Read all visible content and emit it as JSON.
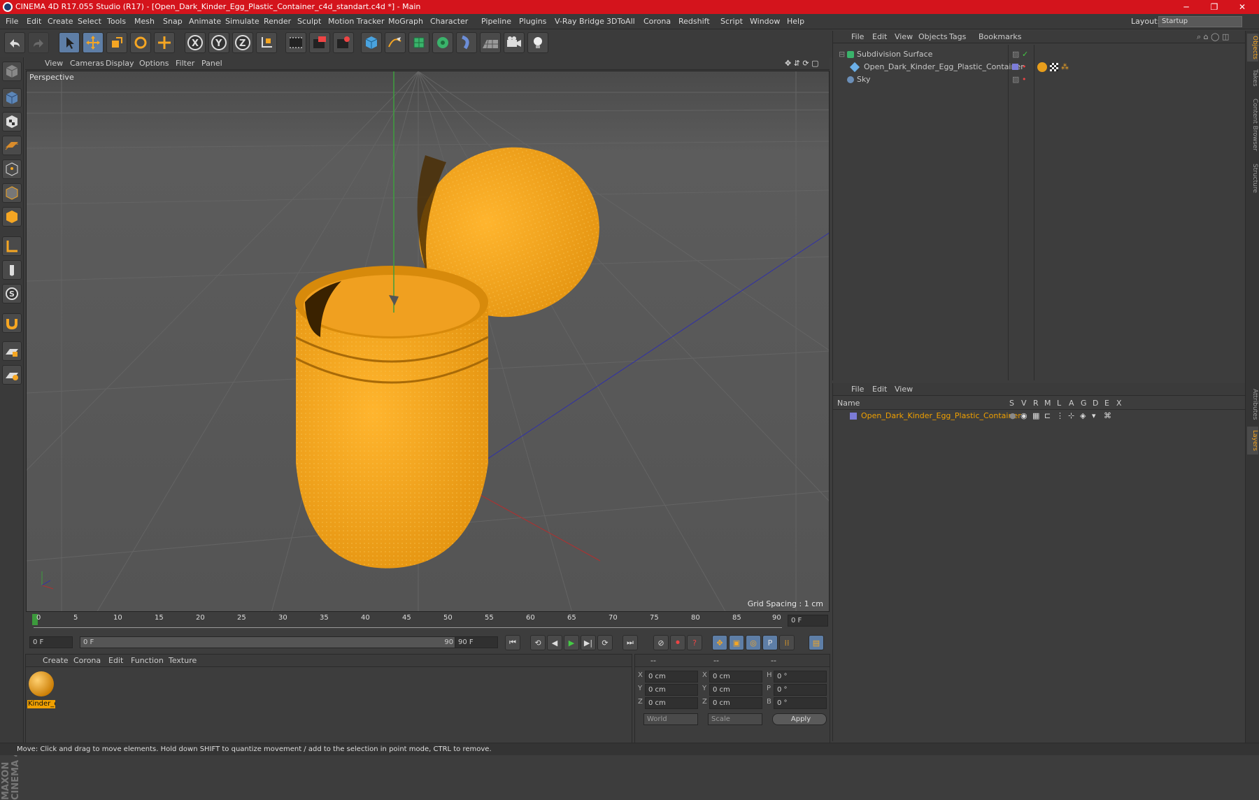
{
  "window": {
    "title": "CINEMA 4D R17.055 Studio (R17) - [Open_Dark_Kinder_Egg_Plastic_Container_c4d_standart.c4d *] - Main",
    "minimize": "─",
    "maximize": "❐",
    "close": "✕"
  },
  "menu": [
    "File",
    "Edit",
    "Create",
    "Select",
    "Tools",
    "Mesh",
    "Snap",
    "Animate",
    "Simulate",
    "Render",
    "Sculpt",
    "Motion Tracker",
    "MoGraph",
    "Character",
    "Pipeline",
    "Plugins",
    "V-Ray Bridge",
    "3DToAll",
    "Corona",
    "Redshift",
    "Script",
    "Window",
    "Help"
  ],
  "layout": {
    "label": "Layout:",
    "value": "Startup"
  },
  "viewport_menu": [
    "View",
    "Cameras",
    "Display",
    "Options",
    "Filter",
    "Panel"
  ],
  "viewport": {
    "name": "Perspective",
    "grid_spacing": "Grid Spacing : 1 cm"
  },
  "timeline": {
    "ticks": [
      "0",
      "5",
      "10",
      "15",
      "20",
      "25",
      "30",
      "35",
      "40",
      "45",
      "50",
      "55",
      "60",
      "65",
      "70",
      "75",
      "80",
      "85",
      "90"
    ],
    "current_frame": "0 F"
  },
  "controls": {
    "start": "0 F",
    "range_start": "0 F",
    "range_end": "90 F",
    "end": "90 F"
  },
  "material_menu": [
    "Create",
    "Corona",
    "Edit",
    "Function",
    "Texture"
  ],
  "material": {
    "name": "Kinder_e"
  },
  "coords": {
    "head": [
      "--",
      "--",
      "--"
    ],
    "rows": [
      [
        "X",
        "0 cm",
        "X",
        "0 cm",
        "H",
        "0 °"
      ],
      [
        "Y",
        "0 cm",
        "Y",
        "0 cm",
        "P",
        "0 °"
      ],
      [
        "Z",
        "0 cm",
        "Z",
        "0 cm",
        "B",
        "0 °"
      ]
    ],
    "world": "World",
    "scale": "Scale",
    "apply": "Apply"
  },
  "objects_menu": [
    "File",
    "Edit",
    "View",
    "Objects",
    "Tags",
    "Bookmarks"
  ],
  "objects": [
    {
      "name": "Subdivision Surface"
    },
    {
      "name": "Open_Dark_Kinder_Egg_Plastic_Container"
    },
    {
      "name": "Sky"
    }
  ],
  "layers_menu": [
    "File",
    "Edit",
    "View"
  ],
  "layers_header": {
    "name": "Name",
    "cols": [
      "S",
      "V",
      "R",
      "M",
      "L",
      "A",
      "G",
      "D",
      "E",
      "X"
    ]
  },
  "layers": [
    {
      "name": "Open_Dark_Kinder_Egg_Plastic_Container"
    }
  ],
  "side_tabs": [
    "Objects",
    "Takes",
    "Content Browser",
    "Structure",
    "Attributes",
    "Layers"
  ],
  "status": "Move: Click and drag to move elements. Hold down SHIFT to quantize movement / add to the selection in point mode, CTRL to remove.",
  "branding": "MAXON CINEMA 4D",
  "colors": {
    "accent": "#d4141c",
    "object": "#f39c12",
    "layer": "#f0a000"
  }
}
